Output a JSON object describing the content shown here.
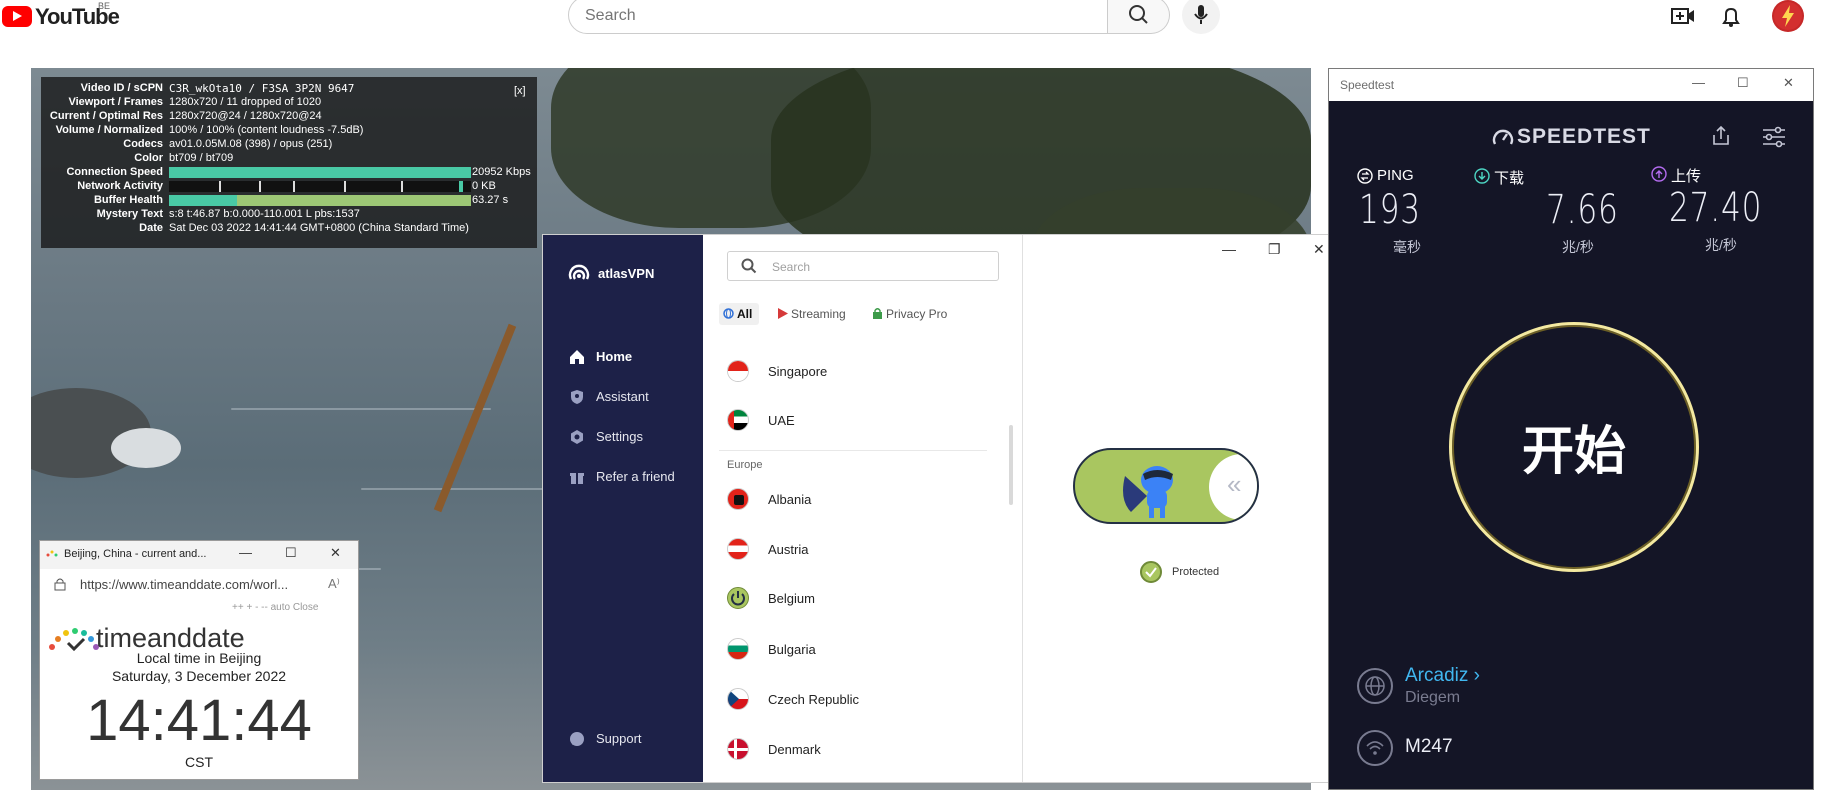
{
  "youtube": {
    "logo_text": "YouTube",
    "region": "BE",
    "search_placeholder": "Search"
  },
  "stats": {
    "close": "[x]",
    "rows": [
      {
        "key": "Video ID / sCPN",
        "value": "C3R_wkOta10 / F3SA 3P2N 9647"
      },
      {
        "key": "Viewport / Frames",
        "value": "1280x720 / 11 dropped of 1020"
      },
      {
        "key": "Current / Optimal Res",
        "value": "1280x720@24 / 1280x720@24"
      },
      {
        "key": "Volume / Normalized",
        "value": "100% / 100% (content loudness -7.5dB)"
      },
      {
        "key": "Codecs",
        "value": "av01.0.05M.08 (398) / opus (251)"
      },
      {
        "key": "Color",
        "value": "bt709 / bt709"
      },
      {
        "key": "Connection Speed",
        "value": "20952 Kbps"
      },
      {
        "key": "Network Activity",
        "value": "0 KB"
      },
      {
        "key": "Buffer Health",
        "value": "63.27 s"
      },
      {
        "key": "Mystery Text",
        "value": "s:8 t:46.87 b:0.000-110.001 L pbs:1537"
      },
      {
        "key": "Date",
        "value": "Sat Dec 03 2022 14:41:44 GMT+0800 (China Standard Time)"
      }
    ]
  },
  "timeanddate": {
    "window_title": "Beijing, China - current and...",
    "url": "https://www.timeanddate.com/worl...",
    "zoom_controls": "++ + - -- auto Close",
    "logo_text": "timeanddate",
    "location": "Local time in Beijing",
    "date": "Saturday, 3 December 2022",
    "time": "14:41:44",
    "timezone": "CST"
  },
  "vpn": {
    "brand": "atlasVPN",
    "nav": [
      {
        "label": "Home",
        "icon": "home-icon"
      },
      {
        "label": "Assistant",
        "icon": "shield-icon"
      },
      {
        "label": "Settings",
        "icon": "gear-icon"
      },
      {
        "label": "Refer a friend",
        "icon": "gift-icon"
      }
    ],
    "support": "Support",
    "search_placeholder": "Search",
    "tabs": [
      "All",
      "Streaming",
      "Privacy Pro"
    ],
    "countries_top": [
      "Singapore",
      "UAE"
    ],
    "region_label": "Europe",
    "countries_europe": [
      "Albania",
      "Austria",
      "Belgium",
      "Bulgaria",
      "Czech Republic",
      "Denmark"
    ],
    "status": "Protected",
    "accent_color": "#a9c660",
    "sidebar_color": "#1d2148"
  },
  "speedtest": {
    "window_title": "Speedtest",
    "logo": "SPEEDTEST",
    "ping_label": "PING",
    "ping_value": "193",
    "ping_unit": "毫秒",
    "download_label": "下载",
    "download_value": "7.66",
    "download_unit": "兆/秒",
    "upload_label": "上传",
    "upload_value": "27.40",
    "upload_unit": "兆/秒",
    "go_label": "开始",
    "server_name": "Arcadiz",
    "server_location": "Diegem",
    "connection": "M247"
  }
}
